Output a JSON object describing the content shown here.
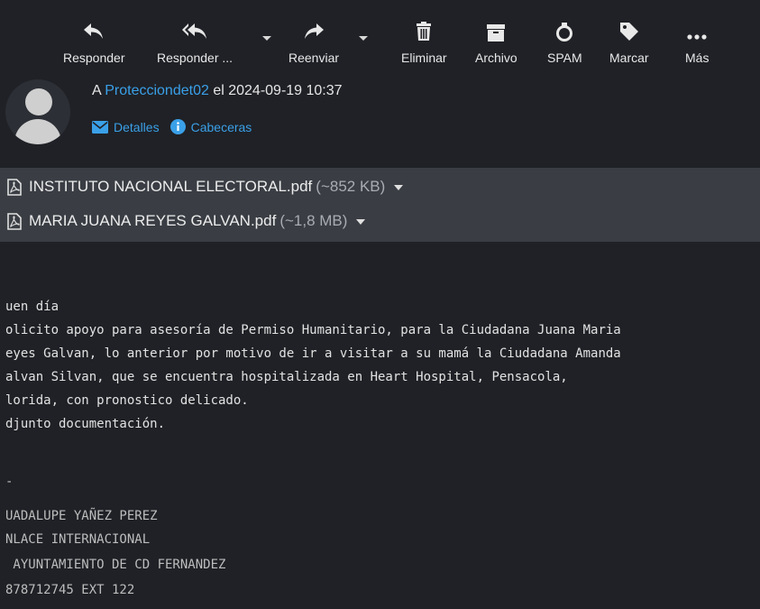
{
  "toolbar": {
    "reply": "Responder",
    "reply_all": "Responder ...",
    "forward": "Reenviar",
    "delete": "Eliminar",
    "archive": "Archivo",
    "spam": "SPAM",
    "mark": "Marcar",
    "more": "Más"
  },
  "header": {
    "to_prefix": "A ",
    "recipient": "Protecciondet02",
    "date_text": " el 2024-09-19 10:37",
    "details_label": "Detalles",
    "headers_label": "Cabeceras"
  },
  "attachments": [
    {
      "name": "INSTITUTO NACIONAL ELECTORAL.pdf",
      "size": "(~852 KB)"
    },
    {
      "name": "MARIA JUANA REYES GALVAN.pdf",
      "size": "(~1,8 MB)"
    }
  ],
  "body": {
    "lines": [
      "uen día",
      "olicito apoyo para asesoría de Permiso Humanitario, para la Ciudadana Juana Maria",
      "eyes Galvan, lo anterior por motivo de ir a visitar a su mamá la Ciudadana Amanda",
      "alvan Silvan, que se encuentra hospitalizada en Heart Hospital, Pensacola,",
      "lorida, con pronostico delicado.",
      "djunto documentación."
    ]
  },
  "signature": {
    "separator": "-",
    "lines": [
      "UADALUPE YAÑEZ PEREZ",
      "NLACE INTERNACIONAL",
      " AYUNTAMIENTO DE CD FERNANDEZ",
      "878712745 EXT 122"
    ]
  },
  "colors": {
    "background": "#1f2126",
    "attachment_bar": "#3a3e44",
    "link": "#3aa0e8"
  },
  "icons": [
    "reply-icon",
    "reply-all-icon",
    "forward-icon",
    "trash-icon",
    "archive-icon",
    "spam-icon",
    "tag-icon",
    "more-icon",
    "envelope-icon",
    "info-icon",
    "pdf-icon"
  ]
}
